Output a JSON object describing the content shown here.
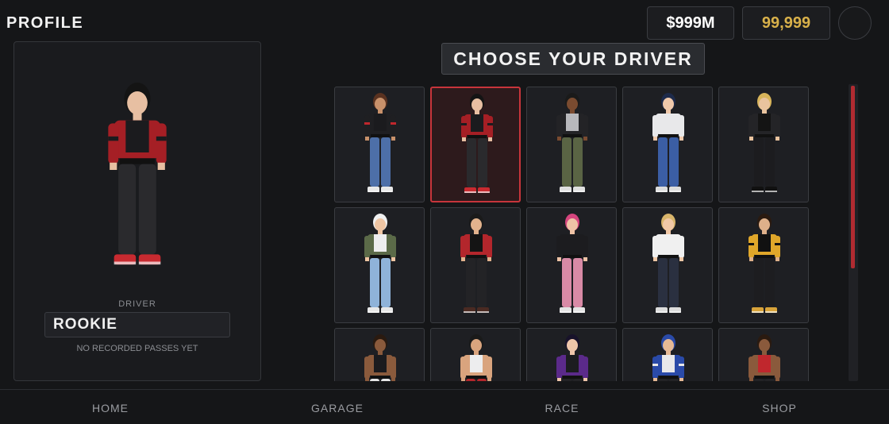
{
  "header": {
    "title": "PROFILE"
  },
  "wallet": {
    "cash": "$999M",
    "coins": "99,999"
  },
  "colors": {
    "accent_red": "#c7353b",
    "coin_gold": "#d9b14a",
    "background": "#151618"
  },
  "profile": {
    "driver_label": "DRIVER",
    "name": "ROOKIE",
    "passes_text": "NO RECORDED PASSES YET"
  },
  "picker": {
    "title": "CHOOSE YOUR DRIVER"
  },
  "drivers": [
    {
      "skin": "#c8916b",
      "hair": "#5a3220",
      "top": "#1b1b1e",
      "jacket": "#1f1f22",
      "stripe": "#c0272d",
      "pants": "#4d6fa8",
      "shoes": "#e8e8e8"
    },
    {
      "skin": "#e7bfa2",
      "hair": "#141414",
      "top": "#1b1b1e",
      "jacket": "#a51f25",
      "stripe": "#1b1b1e",
      "pants": "#2a2a2d",
      "shoes": "#c82a30",
      "selected": true
    },
    {
      "skin": "#7a4b30",
      "hair": "#1a1a1a",
      "top": "#b8b8bc",
      "jacket": "#232326",
      "stripe": "#232326",
      "pants": "#5a6444",
      "shoes": "#e0e0e0"
    },
    {
      "skin": "#f0c9ab",
      "hair": "#1d2a4a",
      "top": "#e8e8ea",
      "jacket": "#e8e8ea",
      "stripe": "#e8e8ea",
      "pants": "#3b5ea4",
      "shoes": "#dcdcdc"
    },
    {
      "skin": "#e9c39e",
      "hair": "#d8b45a",
      "top": "#141414",
      "jacket": "#242427",
      "stripe": "#242427",
      "pants": "#1c1c1f",
      "shoes": "#111111"
    },
    {
      "skin": "#efc5a3",
      "hair": "#f0f0f0",
      "top": "#ededee",
      "jacket": "#5b6a48",
      "stripe": "#5b6a48",
      "pants": "#8fb3d9",
      "shoes": "#e8e8e8"
    },
    {
      "skin": "#e2b28d",
      "hair": "#1a1a1a",
      "top": "#141414",
      "jacket": "#b3262c",
      "stripe": "#b3262c",
      "pants": "#232326",
      "shoes": "#4a2a22"
    },
    {
      "skin": "#efc3a6",
      "hair": "#d6457e",
      "top": "#1c1c1f",
      "jacket": "#1c1c1f",
      "stripe": "#1c1c1f",
      "pants": "#d98aa6",
      "shoes": "#e5e5e5"
    },
    {
      "skin": "#f1c8a6",
      "hair": "#d9b56b",
      "top": "#f0f0f0",
      "jacket": "#f0f0f0",
      "stripe": "#f0f0f0",
      "pants": "#2a3040",
      "shoes": "#dcdcdc"
    },
    {
      "skin": "#deb08a",
      "hair": "#2a1a10",
      "top": "#111111",
      "jacket": "#e0a72a",
      "stripe": "#111111",
      "pants": "#1d1d20",
      "shoes": "#d8a33a"
    },
    {
      "skin": "#8a5a3c",
      "hair": "#2a1a10",
      "top": "#1b1b1e",
      "jacket": "#8a5a3c",
      "stripe": "#8a5a3c",
      "pants": "#e6e6e6",
      "shoes": "#e6e6e6"
    },
    {
      "skin": "#d9a47e",
      "hair": "#1a1a1a",
      "top": "#ededee",
      "jacket": "#d9a47e",
      "stripe": "#d9a47e",
      "pants": "#b3262c",
      "shoes": "#cfcfcf"
    },
    {
      "skin": "#efc6aa",
      "hair": "#18122a",
      "top": "#1c1c1f",
      "jacket": "#5b2a8a",
      "stripe": "#5b2a8a",
      "pants": "#232326",
      "shoes": "#cfcfcf"
    },
    {
      "skin": "#e6b995",
      "hair": "#2a4aa8",
      "top": "#e8e8ea",
      "jacket": "#2a4aa8",
      "stripe": "#e8e8ea",
      "pants": "#232326",
      "shoes": "#cfcfcf"
    },
    {
      "skin": "#8a5a3c",
      "hair": "#2a1a10",
      "top": "#c0272d",
      "jacket": "#8a5a3c",
      "stripe": "#8a5a3c",
      "pants": "#232326",
      "shoes": "#cfcfcf"
    }
  ],
  "nav": {
    "home": "HOME",
    "garage": "GARAGE",
    "race": "RACE",
    "shop": "SHOP"
  }
}
